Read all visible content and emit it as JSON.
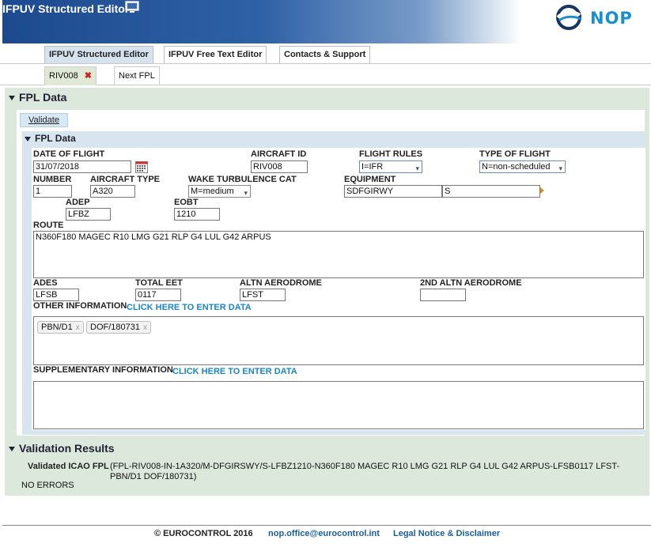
{
  "header": {
    "app_title": "IFPUV Structured Editor",
    "logo_text": "NOP",
    "colors": {
      "banner": "#1d4a8e",
      "logo": "#1c8ec9"
    }
  },
  "tabs": [
    {
      "label": "IFPUV Structured Editor",
      "active": true
    },
    {
      "label": "IFPUV Free Text Editor",
      "active": false
    },
    {
      "label": "Contacts & Support",
      "active": false
    }
  ],
  "flight_tabs": [
    {
      "label": "RIV008",
      "active": true
    },
    {
      "label": "Next FPL",
      "active": false
    }
  ],
  "fpl_section": {
    "title": "FPL Data",
    "validate_label": "Validate",
    "subtitle": "FPL Data"
  },
  "form": {
    "date_of_flight": {
      "label": "DATE OF FLIGHT",
      "value": "31/07/2018"
    },
    "aircraft_id": {
      "label": "AIRCRAFT ID",
      "value": "RIV008"
    },
    "flight_rules": {
      "label": "FLIGHT RULES",
      "value": "I=IFR"
    },
    "type_of_flight": {
      "label": "TYPE OF FLIGHT",
      "value": "N=non-scheduled"
    },
    "number": {
      "label": "NUMBER",
      "value": "1"
    },
    "aircraft_type": {
      "label": "AIRCRAFT TYPE",
      "value": "A320"
    },
    "wake_turbulence": {
      "label": "WAKE TURBULENCE CAT",
      "value": "M=medium"
    },
    "equipment": {
      "label": "EQUIPMENT",
      "value1": "SDFGIRWY",
      "value2": "S"
    },
    "adep": {
      "label": "ADEP",
      "value": "LFBZ"
    },
    "eobt": {
      "label": "EOBT",
      "value": "1210"
    },
    "route": {
      "label": "ROUTE",
      "value": "N360F180 MAGEC R10 LMG G21 RLP G4 LUL G42 ARPUS"
    },
    "ades": {
      "label": "ADES",
      "value": "LFSB"
    },
    "total_eet": {
      "label": "TOTAL EET",
      "value": "0117"
    },
    "altn_aerodrome": {
      "label": "ALTN AERODROME",
      "value": "LFST"
    },
    "altn2_aerodrome": {
      "label": "2ND ALTN AERODROME",
      "value": ""
    },
    "other_info": {
      "label": "OTHER INFORMATION",
      "link": "CLICK HERE TO ENTER DATA",
      "chips": [
        "PBN/D1",
        "DOF/180731"
      ],
      "chip_remove": "x"
    },
    "supplementary_info": {
      "label": "SUPPLEMENTARY INFORMATION",
      "link": "CLICK HERE TO ENTER DATA"
    }
  },
  "validation": {
    "title": "Validation Results",
    "icao_label": "Validated ICAO FPL",
    "icao_text": "(FPL-RIV008-IN-1A320/M-DFGIRSWY/S-LFBZ1210-N360F180 MAGEC R10 LMG G21 RLP G4 LUL G42 ARPUS-LFSB0117 LFST-PBN/D1 DOF/180731)",
    "status": "NO ERRORS"
  },
  "footer": {
    "copyright": "© EUROCONTROL 2016",
    "email": "nop.office@eurocontrol.int",
    "legal": "Legal Notice & Disclaimer"
  }
}
